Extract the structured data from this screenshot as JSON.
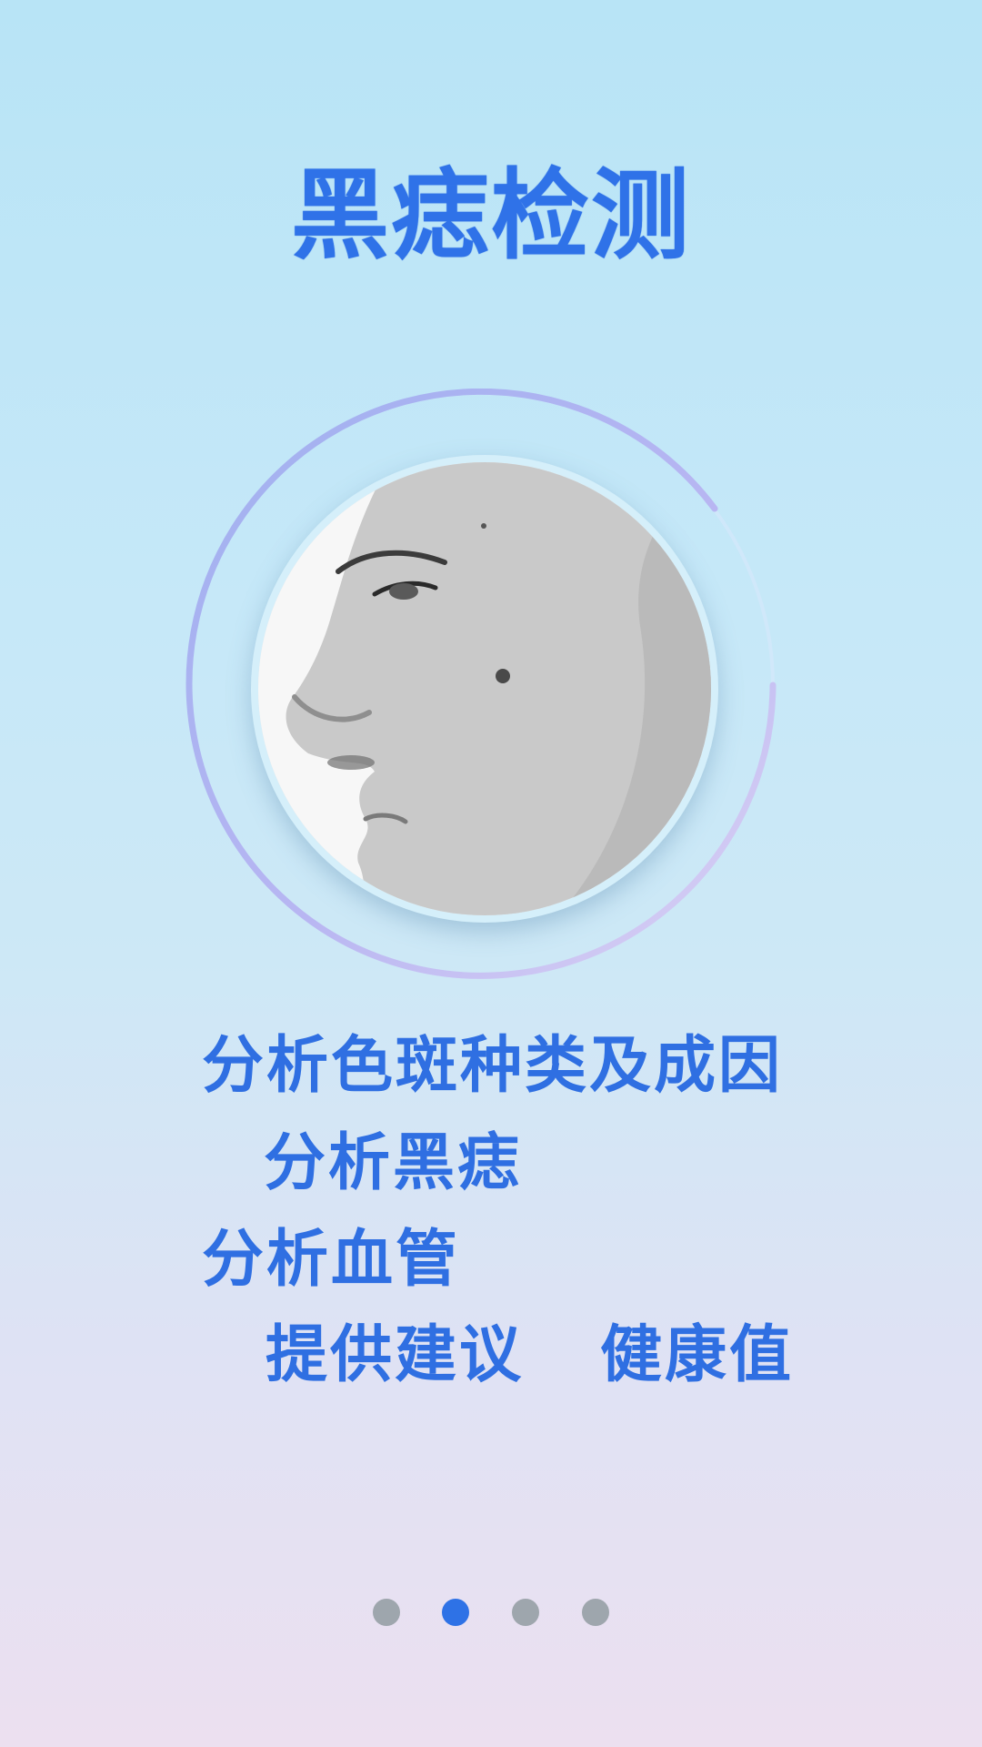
{
  "title": "黑痣检测",
  "features": {
    "line1": "分析色斑种类及成因",
    "line2": "分析黑痣",
    "line3": "分析血管",
    "line4a": "提供建议",
    "line4b": "健康值"
  },
  "pagination": {
    "total": 4,
    "active_index": 1
  },
  "colors": {
    "accent": "#2f72e8",
    "ring_start": "#9fb0f0",
    "ring_end": "#d8c9f2",
    "dot_inactive": "#9ea6ad"
  },
  "illustration": {
    "semantic": "face-profile-photo"
  }
}
